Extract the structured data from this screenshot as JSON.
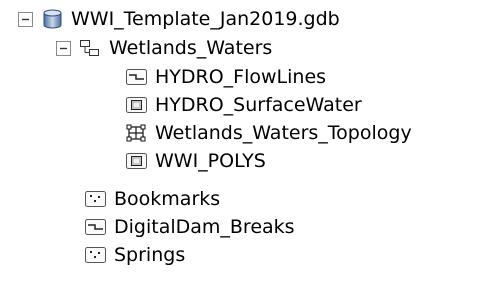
{
  "catalog_tree": {
    "geodatabase": {
      "label": "WWI_Template_Jan2019.gdb",
      "expanded": true,
      "icon": "geodatabase-icon"
    },
    "feature_dataset": {
      "label": "Wetlands_Waters",
      "expanded": true,
      "icon": "feature-dataset-icon",
      "children": [
        {
          "label": "HYDRO_FlowLines",
          "icon": "line-feature-class-icon"
        },
        {
          "label": "HYDRO_SurfaceWater",
          "icon": "polygon-feature-class-icon"
        },
        {
          "label": "Wetlands_Waters_Topology",
          "icon": "topology-icon"
        },
        {
          "label": "WWI_POLYS",
          "icon": "polygon-feature-class-icon"
        }
      ]
    },
    "feature_classes": [
      {
        "label": "Bookmarks",
        "icon": "point-feature-class-icon"
      },
      {
        "label": "DigitalDam_Breaks",
        "icon": "line-feature-class-icon"
      },
      {
        "label": "Springs",
        "icon": "point-feature-class-icon"
      }
    ]
  }
}
